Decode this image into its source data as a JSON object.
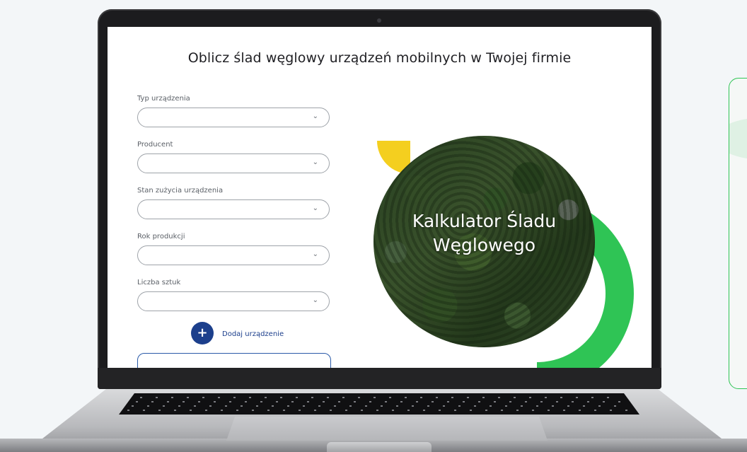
{
  "page": {
    "title": "Oblicz ślad węglowy urządzeń mobilnych w Twojej firmie"
  },
  "form": {
    "fields": [
      {
        "label": "Typ urządzenia",
        "value": ""
      },
      {
        "label": "Producent",
        "value": ""
      },
      {
        "label": "Stan zużycia urządzenia",
        "value": ""
      },
      {
        "label": "Rok produkcji",
        "value": ""
      },
      {
        "label": "Liczba sztuk",
        "value": ""
      }
    ],
    "chevron_icon": "chevron-down-icon",
    "add_button_symbol": "+",
    "add_button_label": "Dodaj urządzenie"
  },
  "hero": {
    "title_line1": "Kalkulator Śladu",
    "title_line2": "Węglowego"
  },
  "colors": {
    "accent_green": "#2fc455",
    "accent_yellow": "#f4cf1f",
    "primary_blue": "#1c3f8c"
  }
}
